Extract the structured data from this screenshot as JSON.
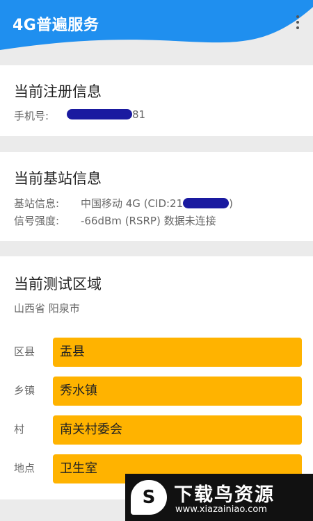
{
  "app": {
    "title": "4G普遍服务",
    "menu_icon": "more-vert-icon",
    "accent_color": "#1f8fef"
  },
  "registration": {
    "title": "当前注册信息",
    "phone_label": "手机号:",
    "phone_suffix": "81"
  },
  "base_station": {
    "title": "当前基站信息",
    "station_label": "基站信息:",
    "station_value": "中国移动 4G (CID:21",
    "station_close": ")",
    "signal_label": "信号强度:",
    "signal_value": "-66dBm (RSRP) 数据未连接"
  },
  "test_area": {
    "title": "当前测试区域",
    "region": "山西省 阳泉市",
    "rows": [
      {
        "label": "区县",
        "value": "盂县"
      },
      {
        "label": "乡镇",
        "value": "秀水镇"
      },
      {
        "label": "村",
        "value": "南关村委会"
      },
      {
        "label": "地点",
        "value": "卫生室"
      }
    ],
    "field_color": "#ffb300"
  },
  "watermark": {
    "logo_glyph": "S",
    "text": "下载鸟资源",
    "url": "www.xiazainiao.com"
  }
}
